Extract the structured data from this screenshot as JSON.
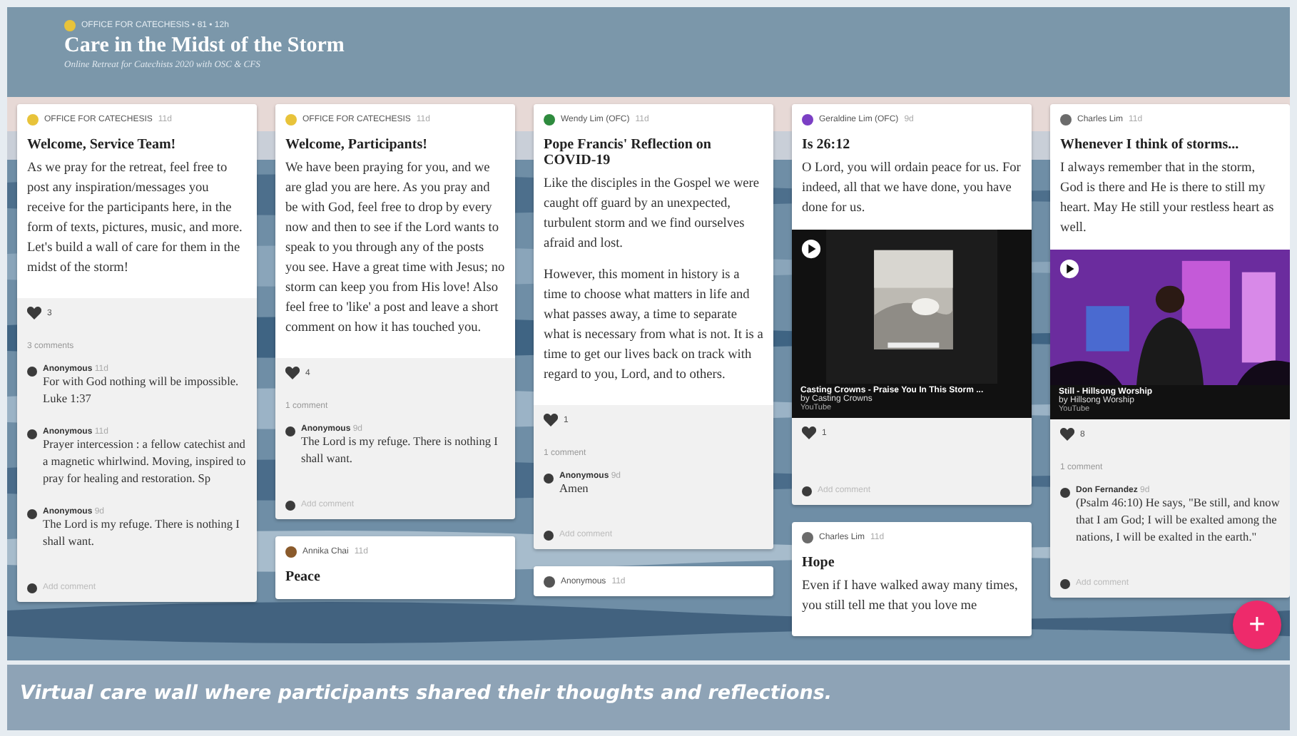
{
  "header": {
    "meta": "OFFICE FOR CATECHESIS • 81 • 12h",
    "title": "Care in the Midst of the Storm",
    "subtitle": "Online Retreat for Catechists 2020 with OSC & CFS"
  },
  "columns": [
    {
      "posts": [
        {
          "author": "OFFICE FOR CATECHESIS",
          "time": "11d",
          "color": "#e8c33a",
          "title": "Welcome, Service Team!",
          "body": [
            "As we pray for the retreat, feel free to post any inspiration/messages you receive for the participants here, in the form of texts, pictures, music, and more. Let's build a wall of care for them in the midst of the storm!"
          ],
          "likes": "3",
          "comment_count": "3 comments",
          "comments": [
            {
              "name": "Anonymous",
              "time": "11d",
              "text": "For with God nothing will be impossible. Luke 1:37"
            },
            {
              "name": "Anonymous",
              "time": "11d",
              "text": "Prayer intercession : a fellow catechist and a magnetic whirlwind. Moving, inspired to pray for healing and restoration. Sp"
            },
            {
              "name": "Anonymous",
              "time": "9d",
              "text": "The Lord is my refuge. There is nothing I shall want."
            }
          ],
          "comment_field": {
            "placeholder": "Add comment"
          }
        }
      ]
    },
    {
      "posts": [
        {
          "author": "OFFICE FOR CATECHESIS",
          "time": "11d",
          "color": "#e8c33a",
          "title": "Welcome, Participants!",
          "body": [
            "We have been praying for you, and we are glad you are here. As you pray and be with God, feel free to drop by every now and then to see if the Lord wants to speak to you through any of the posts you see. Have a great time with Jesus; no storm can keep you from His love! Also feel free to 'like' a post and leave a short comment on how it has touched you."
          ],
          "likes": "4",
          "comment_count": "1 comment",
          "comments": [
            {
              "name": "Anonymous",
              "time": "9d",
              "text": "The Lord is my refuge. There is nothing I shall want."
            }
          ],
          "comment_field": {
            "placeholder": "Add comment"
          }
        },
        {
          "author": "Annika Chai",
          "time": "11d",
          "color": "#8a5a2b",
          "title": "Peace"
        }
      ]
    },
    {
      "posts": [
        {
          "author": "Wendy Lim (OFC)",
          "time": "11d",
          "color": "#2e8b3e",
          "title": "Pope Francis' Reflection on COVID-19",
          "body": [
            "Like the disciples in the Gospel we were caught off guard by an unexpected, turbulent storm and we find ourselves afraid and lost.",
            "However, this moment in history is a time to choose what matters in life and what passes away, a time to separate what is necessary from what is not. It is a time to get our lives back on track with regard to you, Lord, and to others."
          ],
          "likes": "1",
          "comment_count": "1 comment",
          "comments": [
            {
              "name": "Anonymous",
              "time": "9d",
              "text": "Amen"
            }
          ],
          "comment_field": {
            "placeholder": "Add comment"
          }
        },
        {
          "author": "Anonymous",
          "time": "11d",
          "color": "#555555"
        }
      ]
    },
    {
      "posts": [
        {
          "author": "Geraldine Lim (OFC)",
          "time": "9d",
          "color": "#7b3fc4",
          "title": "Is 26:12",
          "body": [
            "O Lord, you will ordain peace for us. For indeed, all that we have done, you have done for us."
          ],
          "media": {
            "kind": "album",
            "title": "Casting Crowns - Praise You In This Storm ...",
            "byline": "by Casting Crowns",
            "source": "YouTube"
          },
          "likes": "1",
          "comment_field": {
            "placeholder": "Add comment"
          }
        },
        {
          "author": "Charles Lim",
          "time": "11d",
          "color": "#6b6b6b",
          "title": "Hope",
          "body": [
            "Even if I have walked away many times, you still tell me that you love me"
          ]
        }
      ]
    },
    {
      "posts": [
        {
          "author": "Charles Lim",
          "time": "11d",
          "color": "#6b6b6b",
          "title": "Whenever I think of storms...",
          "body": [
            "I always remember that in the storm, God is there and He is there to still my heart. May He still your restless heart as well."
          ],
          "media": {
            "kind": "stage",
            "title": "Still - Hillsong Worship",
            "byline": "by Hillsong Worship",
            "source": "YouTube"
          },
          "likes": "8",
          "comment_count": "1 comment",
          "comments": [
            {
              "name": "Don Fernandez",
              "time": "9d",
              "text": "(Psalm 46:10) He says, \"Be still, and know that I am God; I will be exalted among the nations, I will be exalted in the earth.\""
            }
          ],
          "comment_field": {
            "placeholder": "Add comment"
          }
        }
      ]
    }
  ],
  "add_button": "+",
  "caption": "Virtual care wall where participants shared their thoughts and reflections."
}
